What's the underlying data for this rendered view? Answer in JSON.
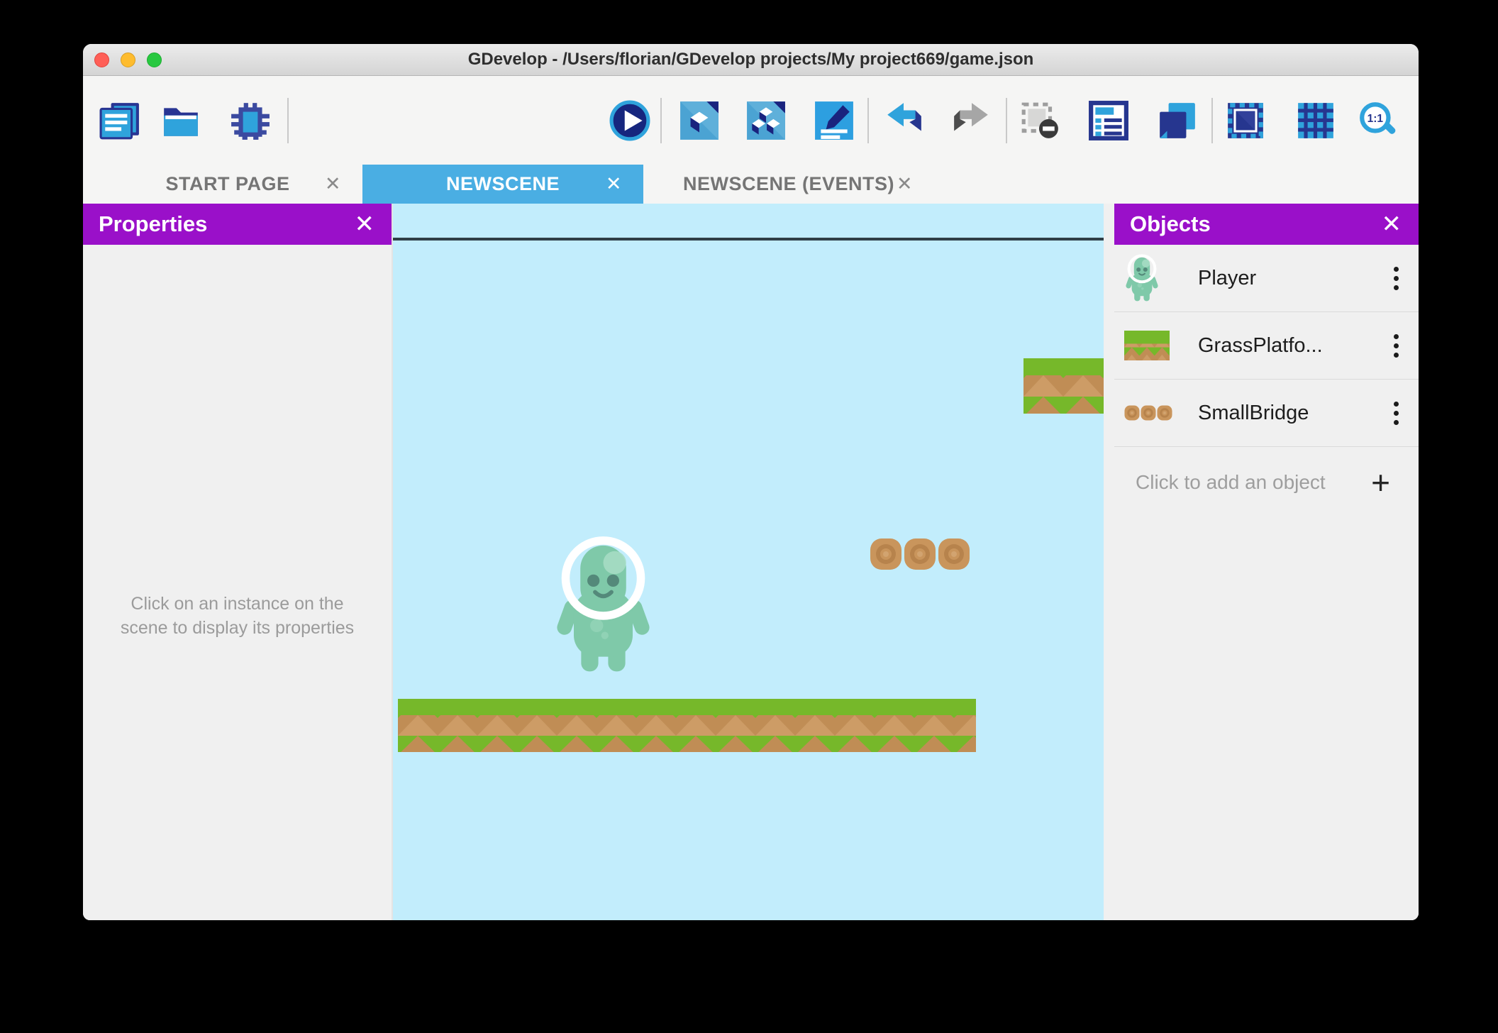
{
  "window": {
    "title": "GDevelop - /Users/florian/GDevelop projects/My project669/game.json"
  },
  "toolbar": {
    "zoom_label": "1:1",
    "icons": [
      "project-manager",
      "open-project",
      "debugger",
      "play-scene",
      "add-object",
      "objects-groups",
      "edit-scene-properties",
      "undo",
      "redo",
      "delete-instances",
      "instances-list",
      "layers",
      "mask-window",
      "grid",
      "zoom-1-1"
    ]
  },
  "tabs": [
    {
      "label": "START PAGE",
      "active": false
    },
    {
      "label": "NEWSCENE",
      "active": true
    },
    {
      "label": "NEWSCENE (EVENTS)",
      "active": false
    }
  ],
  "properties_panel": {
    "title": "Properties",
    "hint": "Click on an instance on the scene to display its properties"
  },
  "objects_panel": {
    "title": "Objects",
    "items": [
      {
        "name": "Player"
      },
      {
        "name": "GrassPlatfo..."
      },
      {
        "name": "SmallBridge"
      }
    ],
    "add_label": "Click to add an object"
  },
  "colors": {
    "accent_purple": "#9a10c9",
    "active_tab_blue": "#4aaee3",
    "scene_sky": "#c2edfc",
    "grass_green": "#76b82a",
    "dirt_brown": "#cb9a64",
    "player_teal": "#7fc9a9"
  }
}
